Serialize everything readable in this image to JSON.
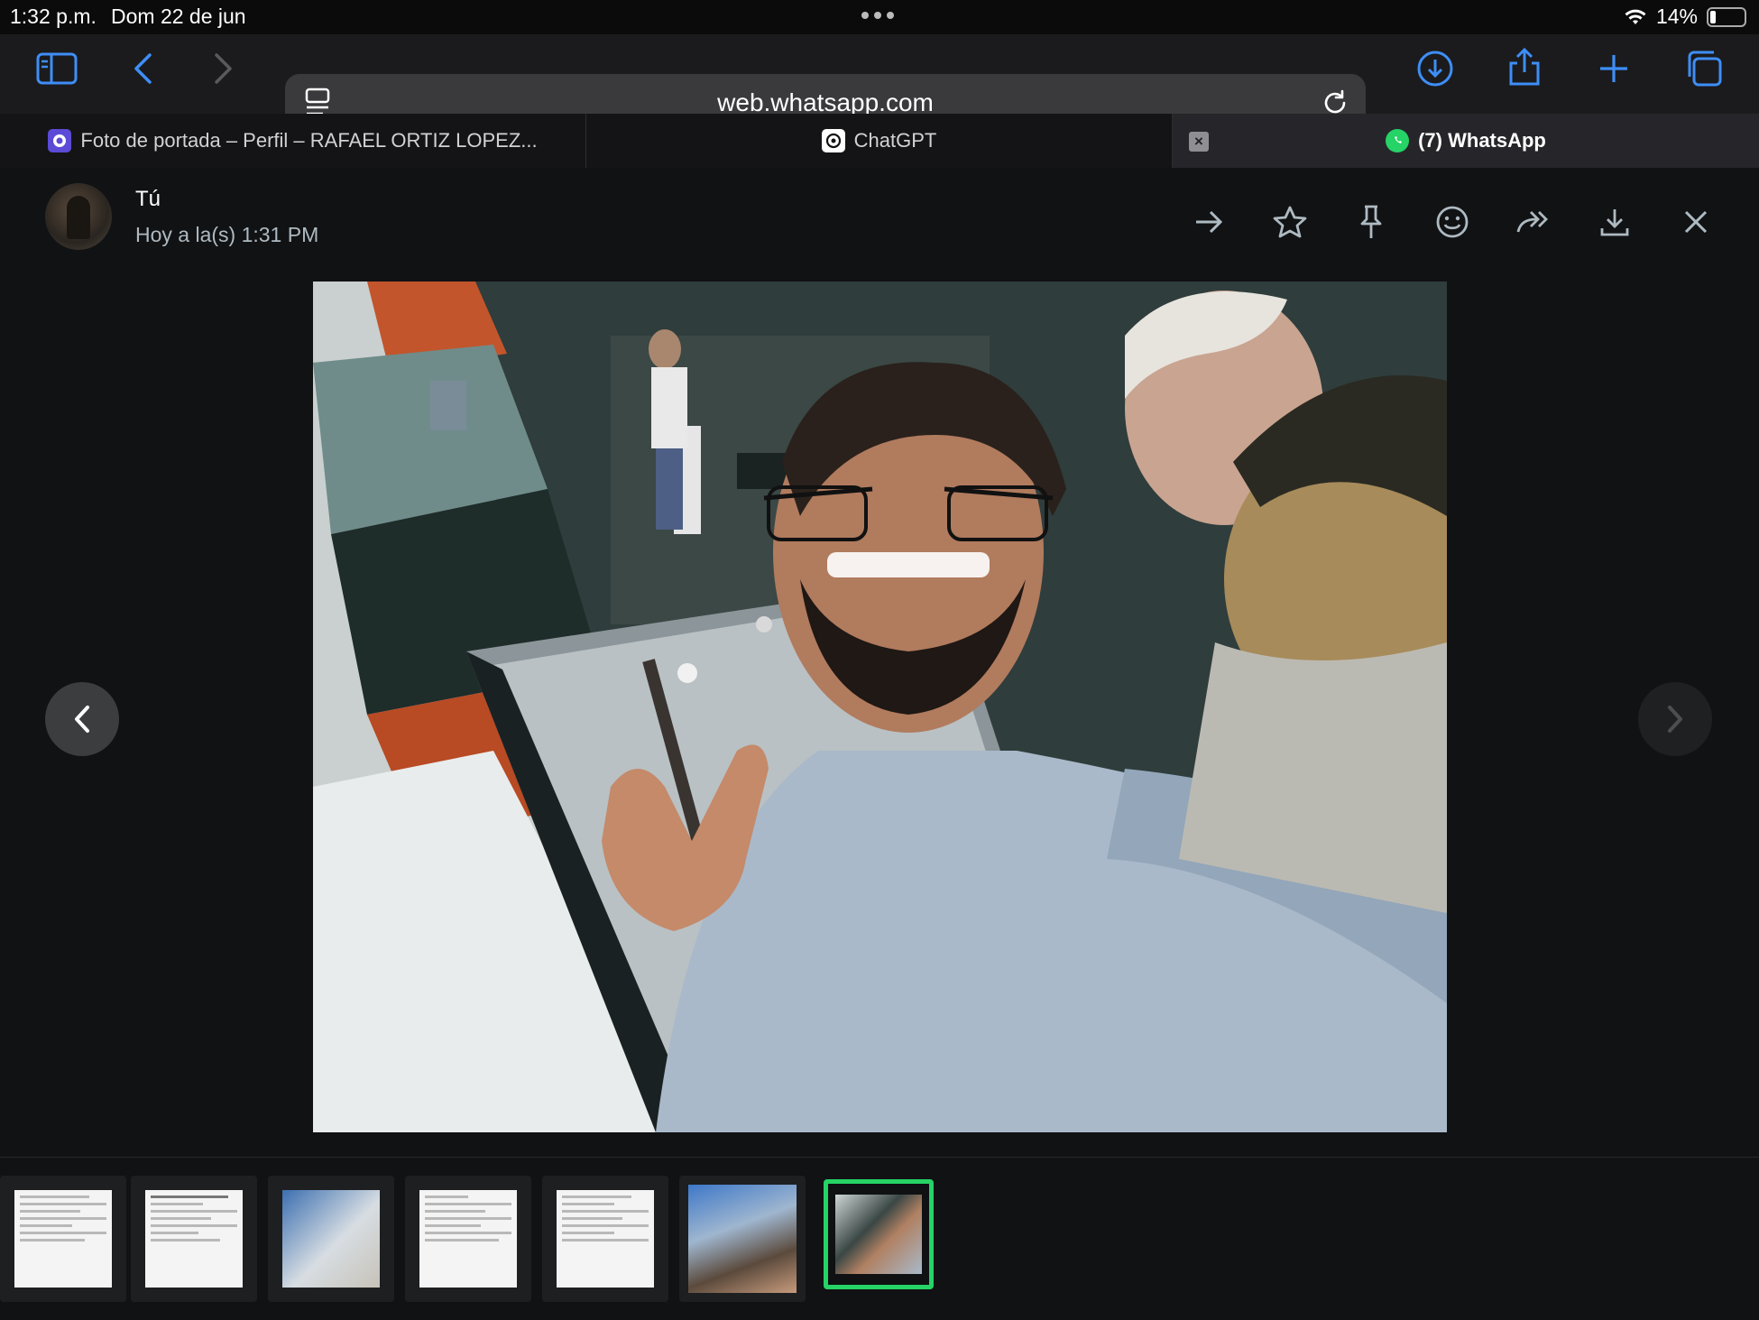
{
  "status_bar": {
    "time": "1:32 p.m.",
    "date": "Dom 22 de jun",
    "battery": "14%"
  },
  "browser": {
    "url": "web.whatsapp.com",
    "tabs": [
      {
        "label": "Foto de portada – Perfil – RAFAEL ORTIZ LOPEZ..."
      },
      {
        "label": "ChatGPT"
      },
      {
        "label": "(7) WhatsApp",
        "active": true
      }
    ]
  },
  "viewer": {
    "sender": "Tú",
    "timestamp": "Hoy a la(s) 1:31 PM",
    "photo_description": "selfie-pool-hall",
    "thumbnail_count": 7,
    "selected_thumbnail": 7,
    "accent": "#25d366"
  }
}
